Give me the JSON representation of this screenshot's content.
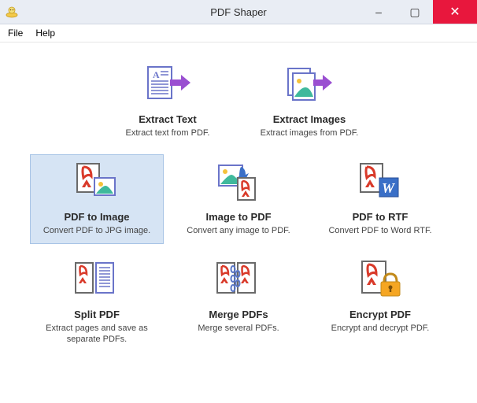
{
  "titlebar": {
    "title": "PDF Shaper",
    "minimize": "–",
    "maximize": "▢",
    "close": "✕"
  },
  "menu": {
    "file": "File",
    "help": "Help"
  },
  "tools": {
    "extract_text": {
      "title": "Extract Text",
      "desc": "Extract text from PDF."
    },
    "extract_images": {
      "title": "Extract Images",
      "desc": "Extract images from PDF."
    },
    "pdf_to_image": {
      "title": "PDF to Image",
      "desc": "Convert PDF to JPG image."
    },
    "image_to_pdf": {
      "title": "Image to PDF",
      "desc": "Convert any image to PDF."
    },
    "pdf_to_rtf": {
      "title": "PDF to RTF",
      "desc": "Convert PDF to Word RTF."
    },
    "split_pdf": {
      "title": "Split PDF",
      "desc": "Extract pages and save as separate PDFs."
    },
    "merge_pdfs": {
      "title": "Merge PDFs",
      "desc": "Merge several PDFs."
    },
    "encrypt_pdf": {
      "title": "Encrypt PDF",
      "desc": "Encrypt and decrypt PDF."
    }
  },
  "selected_tool": "pdf_to_image"
}
